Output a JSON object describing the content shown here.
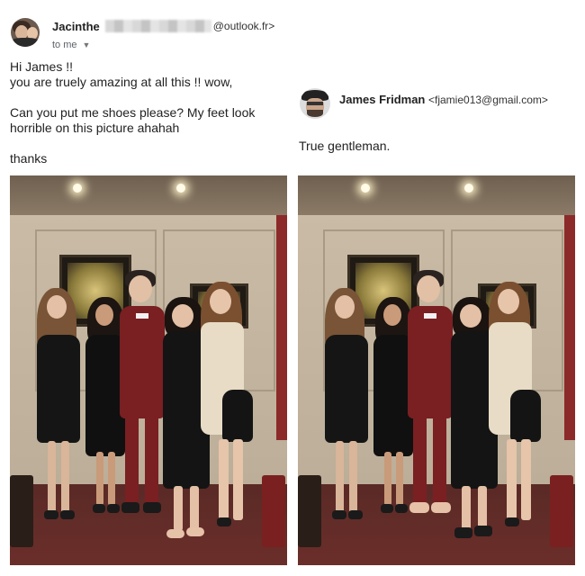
{
  "email_left": {
    "sender_name": "Jacinthe",
    "sender_domain": "@outlook.fr>",
    "to_label": "to me",
    "lines": [
      "Hi James !!",
      "you are truely amazing at all this !! wow,",
      "",
      "Can you put me shoes please? My feet look",
      "horrible on this picture ahahah",
      "",
      "thanks"
    ]
  },
  "email_right": {
    "sender_name": "James Fridman",
    "sender_email": "<fjamie013@gmail.com>",
    "message": "True gentleman."
  },
  "icons": {
    "caret": "chevron-down-icon"
  }
}
